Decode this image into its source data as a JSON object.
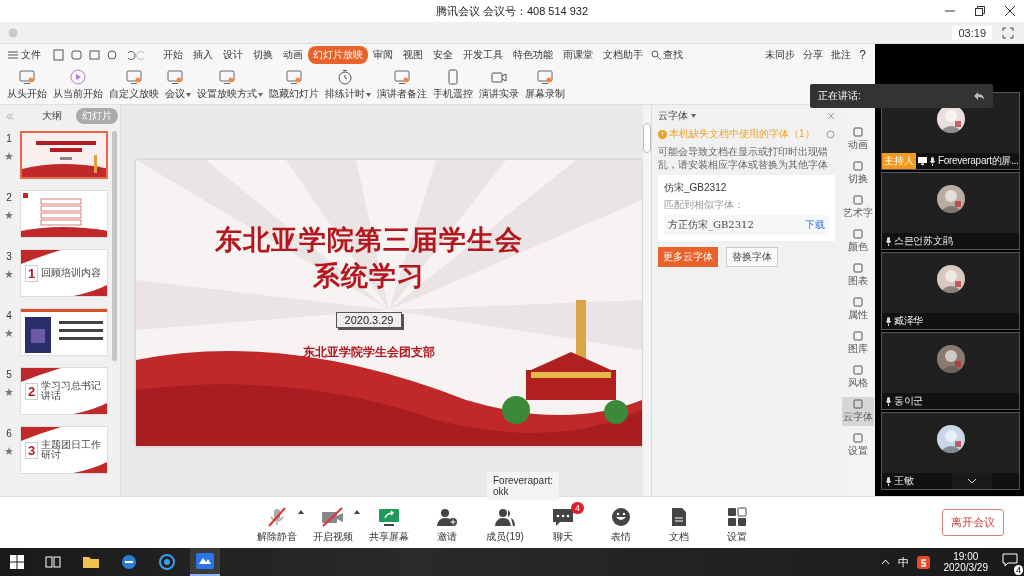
{
  "window": {
    "title": "腾讯会议 会议号：408 514 932",
    "timer": "03:19"
  },
  "wps": {
    "file_menu": "文件",
    "tabs": [
      {
        "label": "开始",
        "selected": false
      },
      {
        "label": "插入",
        "selected": false
      },
      {
        "label": "设计",
        "selected": false
      },
      {
        "label": "切换",
        "selected": false
      },
      {
        "label": "动画",
        "selected": false
      },
      {
        "label": "幻灯片放映",
        "selected": true
      },
      {
        "label": "审阅",
        "selected": false
      },
      {
        "label": "视图",
        "selected": false
      },
      {
        "label": "安全",
        "selected": false
      },
      {
        "label": "开发工具",
        "selected": false
      },
      {
        "label": "特色功能",
        "selected": false
      },
      {
        "label": "雨课堂",
        "selected": false
      },
      {
        "label": "文档助手",
        "selected": false
      }
    ],
    "search": "查找",
    "sync": "未同步",
    "share": "分享",
    "comment": "批注",
    "help": "?",
    "ribbon": [
      {
        "label": "从头开始",
        "kind": "screen",
        "dropdown": false
      },
      {
        "label": "从当前开始",
        "kind": "play",
        "dropdown": false
      },
      {
        "label": "自定义放映",
        "kind": "screen",
        "dropdown": false
      },
      {
        "label": "会议",
        "kind": "screen",
        "dropdown": true
      },
      {
        "label": "设置放映方式",
        "kind": "screen",
        "dropdown": true
      },
      {
        "label": "隐藏幻灯片",
        "kind": "screen",
        "dropdown": false
      },
      {
        "label": "排练计时",
        "kind": "stopwatch",
        "dropdown": true
      },
      {
        "label": "演讲者备注",
        "kind": "screen",
        "dropdown": false
      },
      {
        "label": "手机遥控",
        "kind": "phone",
        "dropdown": false
      },
      {
        "label": "演讲实录",
        "kind": "camera",
        "dropdown": false
      },
      {
        "label": "屏幕录制",
        "kind": "screen",
        "dropdown": false
      }
    ],
    "panel_tabs": [
      {
        "label": "大纲",
        "selected": false
      },
      {
        "label": "幻灯片",
        "selected": true
      }
    ],
    "slides": [
      {
        "number": "1",
        "kind": "title",
        "selected": true
      },
      {
        "number": "2",
        "kind": "agenda",
        "selected": false
      },
      {
        "number": "3",
        "kind": "section",
        "selected": false,
        "section_number": "1",
        "title": "回顾培训内容"
      },
      {
        "number": "4",
        "kind": "poster",
        "selected": false
      },
      {
        "number": "5",
        "kind": "section",
        "selected": false,
        "section_number": "2",
        "title": "学习习总书记讲话"
      },
      {
        "number": "6",
        "kind": "section",
        "selected": false,
        "section_number": "3",
        "title": "主题团日工作研讨"
      }
    ],
    "slide": {
      "title_lines": [
        "东北亚学院第三届学生会",
        "系统学习"
      ],
      "date": "2020.3.29",
      "organizer": "东北亚学院学生会团支部"
    },
    "font_panel": {
      "title": "云字体",
      "warning": "本机缺失文档中使用的字体（1）",
      "description": "可能会导致文档在显示或打印时出现错乱，请安装相应字体或替换为其他字体",
      "missing_font": "仿宋_GB2312",
      "match_label": "匹配到相似字体：",
      "match_font": "方正仿宋_GB2312",
      "download": "下载",
      "more_button": "更多云字体",
      "replace_button": "替换字体"
    },
    "side_tools": [
      {
        "label": "动画",
        "selected": false
      },
      {
        "label": "切换",
        "selected": false
      },
      {
        "label": "艺术字",
        "selected": false
      },
      {
        "label": "颜色",
        "selected": false
      },
      {
        "label": "图表",
        "selected": false
      },
      {
        "label": "属性",
        "selected": false
      },
      {
        "label": "图库",
        "selected": false
      },
      {
        "label": "风格",
        "selected": false
      },
      {
        "label": "云字体",
        "selected": true
      },
      {
        "label": "设置",
        "selected": false
      }
    ]
  },
  "speaking": {
    "label": "正在讲话:"
  },
  "participants": [
    {
      "name": "Foreverapart的屏...",
      "badge": "主持人",
      "color": "#e8e0dc"
    },
    {
      "name": "스믄언苏文鹃",
      "color": "#b9aca0"
    },
    {
      "name": "臧泽华",
      "color": "#d8c8c0"
    },
    {
      "name": "동이군",
      "color": "#8a7a70"
    },
    {
      "name": "王敏",
      "color": "#c8d8e8"
    }
  ],
  "chat_bubble": {
    "sender": "Foreverapart:",
    "message": "okk"
  },
  "toolbar": [
    {
      "label": "解除静音",
      "kind": "mic",
      "off": true,
      "caret": true
    },
    {
      "label": "开启视频",
      "kind": "video",
      "off": true,
      "caret": true
    },
    {
      "label": "共享屏幕",
      "kind": "share"
    },
    {
      "label": "邀请",
      "kind": "invite"
    },
    {
      "label": "成员(19)",
      "kind": "members"
    },
    {
      "label": "聊天",
      "kind": "chat",
      "badge": "4"
    },
    {
      "label": "表情",
      "kind": "emoji"
    },
    {
      "label": "文档",
      "kind": "doc"
    },
    {
      "label": "设置",
      "kind": "settings"
    }
  ],
  "leave_button": "离开会议",
  "taskbar": {
    "apps": [
      {
        "kind": "taskview",
        "selected": false
      },
      {
        "kind": "folder",
        "selected": false
      },
      {
        "kind": "edge",
        "selected": false
      },
      {
        "kind": "ie",
        "selected": false
      },
      {
        "kind": "meeting",
        "selected": true
      }
    ],
    "ime": "中",
    "time": "19:00",
    "date": "2020/3/29",
    "notifications": "4"
  }
}
